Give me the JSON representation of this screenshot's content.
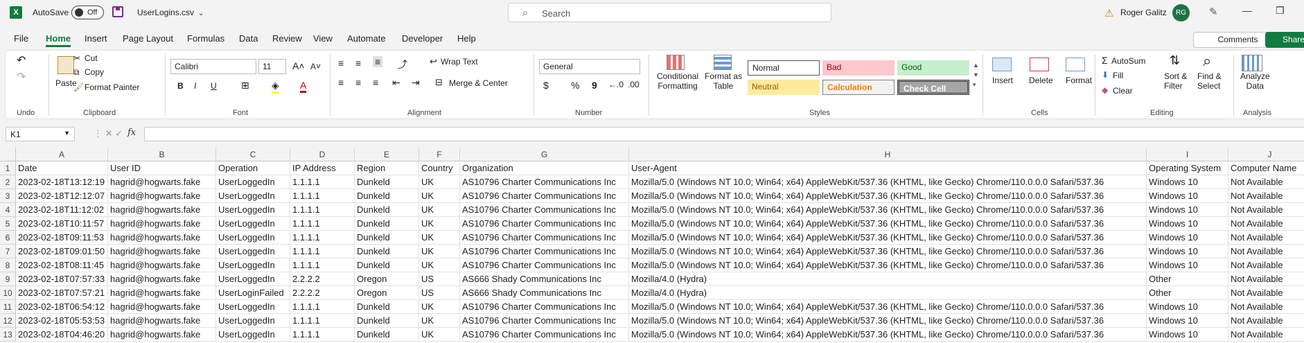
{
  "titlebar": {
    "app_logo": "X",
    "autosave_label": "AutoSave",
    "autosave_state": "Off",
    "filename": "UserLogins.csv",
    "search_placeholder": "Search",
    "user_name": "Roger Galitz",
    "user_initials": "RG"
  },
  "ribbon_tabs": [
    "File",
    "Home",
    "Insert",
    "Page Layout",
    "Formulas",
    "Data",
    "Review",
    "View",
    "Automate",
    "Developer",
    "Help"
  ],
  "ribbon_actions": {
    "comments": "Comments",
    "share": "Share"
  },
  "clipboard": {
    "paste": "Paste",
    "cut": "Cut",
    "copy": "Copy",
    "format_painter": "Format Painter",
    "label": "Clipboard",
    "undo_label": "Undo"
  },
  "font": {
    "name": "Calibri",
    "size": "11",
    "label": "Font",
    "bold": "B",
    "italic": "I",
    "underline": "U"
  },
  "alignment": {
    "wrap_text": "Wrap Text",
    "merge_center": "Merge & Center",
    "label": "Alignment"
  },
  "number": {
    "format": "General",
    "label": "Number",
    "currency": "$",
    "percent": "%",
    "comma": "9"
  },
  "styles": {
    "conditional_formatting": [
      "Conditional",
      "Formatting"
    ],
    "format_as_table": [
      "Format as",
      "Table"
    ],
    "cells": [
      {
        "label": "Normal",
        "bg": "#ffffff",
        "fg": "#000000"
      },
      {
        "label": "Bad",
        "bg": "#ffc7ce",
        "fg": "#9c0006"
      },
      {
        "label": "Good",
        "bg": "#c6efce",
        "fg": "#006100"
      },
      {
        "label": "Neutral",
        "bg": "#ffeb9c",
        "fg": "#9c5700"
      },
      {
        "label": "Calculation",
        "bg": "#f2f2f2",
        "fg": "#fa7d00"
      },
      {
        "label": "Check Cell",
        "bg": "#a5a5a5",
        "fg": "#ffffff"
      }
    ],
    "label": "Styles"
  },
  "cells_group": {
    "insert": "Insert",
    "delete": "Delete",
    "format": "Format",
    "label": "Cells"
  },
  "editing": {
    "autosum": "AutoSum",
    "fill": "Fill",
    "clear": "Clear",
    "sort_filter": [
      "Sort &",
      "Filter"
    ],
    "find_select": [
      "Find &",
      "Select"
    ],
    "label": "Editing"
  },
  "analysis": {
    "analyze_data": [
      "Analyze",
      "Data"
    ],
    "label": "Analysis"
  },
  "formula_bar": {
    "name_box": "K1",
    "fx": "fx",
    "formula": ""
  },
  "columns": [
    "A",
    "B",
    "C",
    "D",
    "E",
    "F",
    "G",
    "H",
    "I",
    "J"
  ],
  "row_numbers": [
    "1",
    "2",
    "3",
    "4",
    "5",
    "6",
    "7",
    "8",
    "9",
    "10",
    "11",
    "12",
    "13"
  ],
  "sheet_rows": [
    [
      "Date",
      "User ID",
      "Operation",
      "IP Address",
      "Region",
      "Country",
      "Organization",
      "User-Agent",
      "Operating System",
      "Computer Name"
    ],
    [
      "2023-02-18T13:12:19",
      "hagrid@hogwarts.fake",
      "UserLoggedIn",
      "1.1.1.1",
      "Dunkeld",
      "UK",
      "AS10796 Charter Communications Inc",
      "Mozilla/5.0 (Windows NT 10.0; Win64; x64) AppleWebKit/537.36 (KHTML, like Gecko) Chrome/110.0.0.0 Safari/537.36",
      "Windows 10",
      "Not Available"
    ],
    [
      "2023-02-18T12:12:07",
      "hagrid@hogwarts.fake",
      "UserLoggedIn",
      "1.1.1.1",
      "Dunkeld",
      "UK",
      "AS10796 Charter Communications Inc",
      "Mozilla/5.0 (Windows NT 10.0; Win64; x64) AppleWebKit/537.36 (KHTML, like Gecko) Chrome/110.0.0.0 Safari/537.36",
      "Windows 10",
      "Not Available"
    ],
    [
      "2023-02-18T11:12:02",
      "hagrid@hogwarts.fake",
      "UserLoggedIn",
      "1.1.1.1",
      "Dunkeld",
      "UK",
      "AS10796 Charter Communications Inc",
      "Mozilla/5.0 (Windows NT 10.0; Win64; x64) AppleWebKit/537.36 (KHTML, like Gecko) Chrome/110.0.0.0 Safari/537.36",
      "Windows 10",
      "Not Available"
    ],
    [
      "2023-02-18T10:11:57",
      "hagrid@hogwarts.fake",
      "UserLoggedIn",
      "1.1.1.1",
      "Dunkeld",
      "UK",
      "AS10796 Charter Communications Inc",
      "Mozilla/5.0 (Windows NT 10.0; Win64; x64) AppleWebKit/537.36 (KHTML, like Gecko) Chrome/110.0.0.0 Safari/537.36",
      "Windows 10",
      "Not Available"
    ],
    [
      "2023-02-18T09:11:53",
      "hagrid@hogwarts.fake",
      "UserLoggedIn",
      "1.1.1.1",
      "Dunkeld",
      "UK",
      "AS10796 Charter Communications Inc",
      "Mozilla/5.0 (Windows NT 10.0; Win64; x64) AppleWebKit/537.36 (KHTML, like Gecko) Chrome/110.0.0.0 Safari/537.36",
      "Windows 10",
      "Not Available"
    ],
    [
      "2023-02-18T09:01:50",
      "hagrid@hogwarts.fake",
      "UserLoggedIn",
      "1.1.1.1",
      "Dunkeld",
      "UK",
      "AS10796 Charter Communications Inc",
      "Mozilla/5.0 (Windows NT 10.0; Win64; x64) AppleWebKit/537.36 (KHTML, like Gecko) Chrome/110.0.0.0 Safari/537.36",
      "Windows 10",
      "Not Available"
    ],
    [
      "2023-02-18T08:11:45",
      "hagrid@hogwarts.fake",
      "UserLoggedIn",
      "1.1.1.1",
      "Dunkeld",
      "UK",
      "AS10796 Charter Communications Inc",
      "Mozilla/5.0 (Windows NT 10.0; Win64; x64) AppleWebKit/537.36 (KHTML, like Gecko) Chrome/110.0.0.0 Safari/537.36",
      "Windows 10",
      "Not Available"
    ],
    [
      "2023-02-18T07:57:33",
      "hagrid@hogwarts.fake",
      "UserLoggedIn",
      "2.2.2.2",
      "Oregon",
      "US",
      "AS666 Shady Communications Inc",
      "Mozilla/4.0 (Hydra)",
      "Other",
      "Not Available"
    ],
    [
      "2023-02-18T07:57:21",
      "hagrid@hogwarts.fake",
      "UserLoginFailed",
      "2.2.2.2",
      "Oregon",
      "US",
      "AS666 Shady Communications Inc",
      "Mozilla/4.0 (Hydra)",
      "Other",
      "Not Available"
    ],
    [
      "2023-02-18T06:54:12",
      "hagrid@hogwarts.fake",
      "UserLoggedIn",
      "1.1.1.1",
      "Dunkeld",
      "UK",
      "AS10796 Charter Communications Inc",
      "Mozilla/5.0 (Windows NT 10.0; Win64; x64) AppleWebKit/537.36 (KHTML, like Gecko) Chrome/110.0.0.0 Safari/537.36",
      "Windows 10",
      "Not Available"
    ],
    [
      "2023-02-18T05:53:53",
      "hagrid@hogwarts.fake",
      "UserLoggedIn",
      "1.1.1.1",
      "Dunkeld",
      "UK",
      "AS10796 Charter Communications Inc",
      "Mozilla/5.0 (Windows NT 10.0; Win64; x64) AppleWebKit/537.36 (KHTML, like Gecko) Chrome/110.0.0.0 Safari/537.36",
      "Windows 10",
      "Not Available"
    ],
    [
      "2023-02-18T04:46:20",
      "hagrid@hogwarts.fake",
      "UserLoggedIn",
      "1.1.1.1",
      "Dunkeld",
      "UK",
      "AS10796 Charter Communications Inc",
      "Mozilla/5.0 (Windows NT 10.0; Win64; x64) AppleWebKit/537.36 (KHTML, like Gecko) Chrome/110.0.0.0 Safari/537.36",
      "Windows 10",
      "Not Available"
    ]
  ],
  "colors": {
    "accent": "#107c41",
    "grid_line": "#e1e1e1"
  }
}
